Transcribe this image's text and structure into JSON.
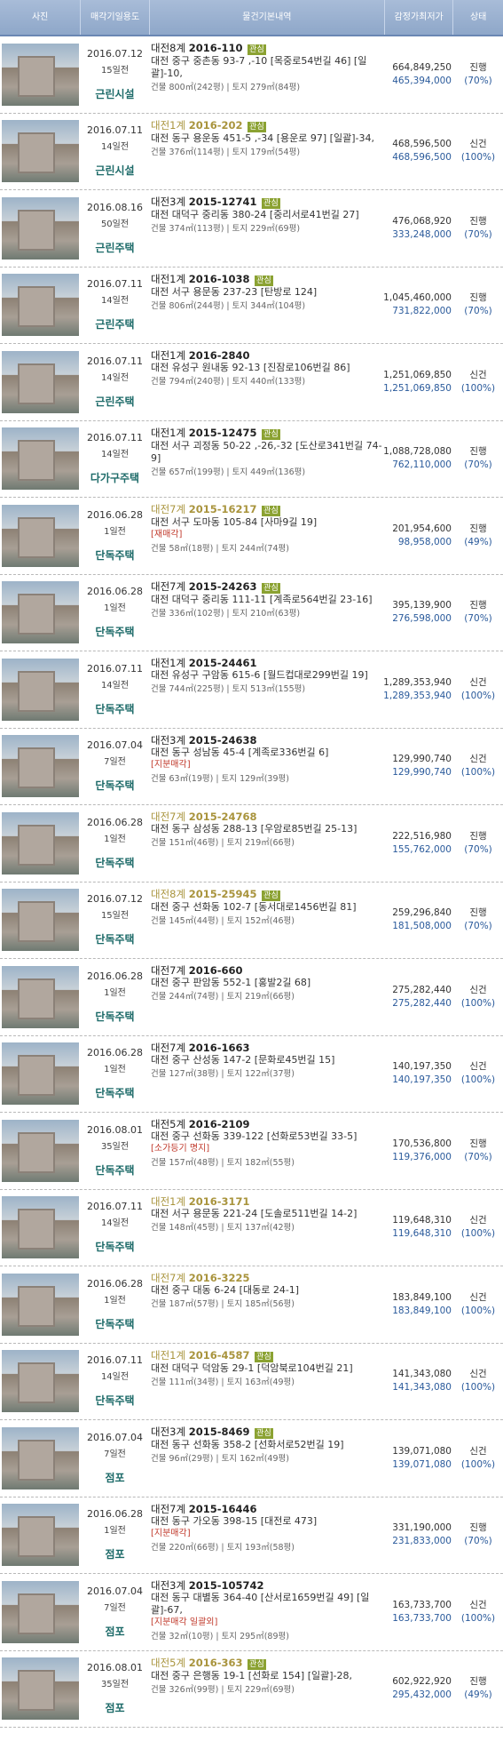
{
  "header": {
    "col_photo": "사진",
    "col_date": "매각기일",
    "col_use": "용도",
    "col_info": "물건기본내역",
    "col_appraisal": "감정가",
    "col_min": "최저가",
    "col_status": "상태"
  },
  "rows": [
    {
      "date": "2016.07.12",
      "days": "15일전",
      "use": "근린시설",
      "court": "대전8계",
      "caseno": "2016-110",
      "gray": false,
      "tag": "관심",
      "addr": "대전 중구 중촌동 93-7 ,-10 [목중로54번길 46] [일괄]-10,",
      "note": "",
      "area": "건물 800㎡(242평) | 토지 279㎡(84평)",
      "appraisal": "664,849,250",
      "min": "465,394,000",
      "status": "진행",
      "pct": "(70%)"
    },
    {
      "date": "2016.07.11",
      "days": "14일전",
      "use": "근린시설",
      "court": "대전1계",
      "caseno": "2016-202",
      "gray": true,
      "tag": "관심",
      "addr": "대전 동구 용운동 451-5 ,-34 [용운로 97] [일괄]-34,",
      "note": "",
      "area": "건물 376㎡(114평) | 토지 179㎡(54평)",
      "appraisal": "468,596,500",
      "min": "468,596,500",
      "status": "신건",
      "pct": "(100%)"
    },
    {
      "date": "2016.08.16",
      "days": "50일전",
      "use": "근린주택",
      "court": "대전3계",
      "caseno": "2015-12741",
      "gray": false,
      "tag": "관심",
      "addr": "대전 대덕구 중리동 380-24 [중리서로41번길 27]",
      "note": "",
      "area": "건물 374㎡(113평) | 토지 229㎡(69평)",
      "appraisal": "476,068,920",
      "min": "333,248,000",
      "status": "진행",
      "pct": "(70%)"
    },
    {
      "date": "2016.07.11",
      "days": "14일전",
      "use": "근린주택",
      "court": "대전1계",
      "caseno": "2016-1038",
      "gray": false,
      "tag": "관심",
      "addr": "대전 서구 용문동 237-23 [탄방로 124]",
      "note": "",
      "area": "건물 806㎡(244평) | 토지 344㎡(104평)",
      "appraisal": "1,045,460,000",
      "min": "731,822,000",
      "status": "진행",
      "pct": "(70%)"
    },
    {
      "date": "2016.07.11",
      "days": "14일전",
      "use": "근린주택",
      "court": "대전1계",
      "caseno": "2016-2840",
      "gray": false,
      "tag": "",
      "addr": "대전 유성구 원내동 92-13 [진잠로106번길 86]",
      "note": "",
      "area": "건물 794㎡(240평) | 토지 440㎡(133평)",
      "appraisal": "1,251,069,850",
      "min": "1,251,069,850",
      "status": "신건",
      "pct": "(100%)"
    },
    {
      "date": "2016.07.11",
      "days": "14일전",
      "use": "다가구주택",
      "court": "대전1계",
      "caseno": "2015-12475",
      "gray": false,
      "tag": "관심",
      "addr": "대전 서구 괴정동 50-22 ,-26,-32 [도산로341번길 74-9]",
      "note": "",
      "area": "건물 657㎡(199평) | 토지 449㎡(136평)",
      "appraisal": "1,088,728,080",
      "min": "762,110,000",
      "status": "진행",
      "pct": "(70%)"
    },
    {
      "date": "2016.06.28",
      "days": "1일전",
      "use": "단독주택",
      "court": "대전7계",
      "caseno": "2015-16217",
      "gray": true,
      "tag": "관심",
      "addr": "대전 서구 도마동 105-84 [사마9길 19]",
      "note": "[재매각]",
      "area": "건물 58㎡(18평) | 토지 244㎡(74평)",
      "appraisal": "201,954,600",
      "min": "98,958,000",
      "status": "진행",
      "pct": "(49%)"
    },
    {
      "date": "2016.06.28",
      "days": "1일전",
      "use": "단독주택",
      "court": "대전7계",
      "caseno": "2015-24263",
      "gray": false,
      "tag": "관심",
      "addr": "대전 대덕구 중리동 111-11 [계족로564번길 23-16]",
      "note": "",
      "area": "건물 336㎡(102평) | 토지 210㎡(63평)",
      "appraisal": "395,139,900",
      "min": "276,598,000",
      "status": "진행",
      "pct": "(70%)"
    },
    {
      "date": "2016.07.11",
      "days": "14일전",
      "use": "단독주택",
      "court": "대전1계",
      "caseno": "2015-24461",
      "gray": false,
      "tag": "",
      "addr": "대전 유성구 구암동 615-6 [월드컵대로299번길 19]",
      "note": "",
      "area": "건물 744㎡(225평) | 토지 513㎡(155평)",
      "appraisal": "1,289,353,940",
      "min": "1,289,353,940",
      "status": "신건",
      "pct": "(100%)"
    },
    {
      "date": "2016.07.04",
      "days": "7일전",
      "use": "단독주택",
      "court": "대전3계",
      "caseno": "2015-24638",
      "gray": false,
      "tag": "",
      "addr": "대전 동구 성남동 45-4 [계족로336번길 6]",
      "note": "[지분매각]",
      "area": "건물 63㎡(19평) | 토지 129㎡(39평)",
      "appraisal": "129,990,740",
      "min": "129,990,740",
      "status": "신건",
      "pct": "(100%)"
    },
    {
      "date": "2016.06.28",
      "days": "1일전",
      "use": "단독주택",
      "court": "대전7계",
      "caseno": "2015-24768",
      "gray": true,
      "tag": "",
      "addr": "대전 동구 삼성동 288-13 [우암로85번길 25-13]",
      "note": "",
      "area": "건물 151㎡(46평) | 토지 219㎡(66평)",
      "appraisal": "222,516,980",
      "min": "155,762,000",
      "status": "진행",
      "pct": "(70%)"
    },
    {
      "date": "2016.07.12",
      "days": "15일전",
      "use": "단독주택",
      "court": "대전8계",
      "caseno": "2015-25945",
      "gray": true,
      "tag": "관심",
      "addr": "대전 중구 선화동 102-7 [동서대로1456번길 81]",
      "note": "",
      "area": "건물 145㎡(44평) | 토지 152㎡(46평)",
      "appraisal": "259,296,840",
      "min": "181,508,000",
      "status": "진행",
      "pct": "(70%)"
    },
    {
      "date": "2016.06.28",
      "days": "1일전",
      "use": "단독주택",
      "court": "대전7계",
      "caseno": "2016-660",
      "gray": false,
      "tag": "",
      "addr": "대전 중구 판암동 552-1 [홍발2길 68]",
      "note": "",
      "area": "건물 244㎡(74평) | 토지 219㎡(66평)",
      "appraisal": "275,282,440",
      "min": "275,282,440",
      "status": "신건",
      "pct": "(100%)"
    },
    {
      "date": "2016.06.28",
      "days": "1일전",
      "use": "단독주택",
      "court": "대전7계",
      "caseno": "2016-1663",
      "gray": false,
      "tag": "",
      "addr": "대전 중구 산성동 147-2 [문화로45번길 15]",
      "note": "",
      "area": "건물 127㎡(38평) | 토지 122㎡(37평)",
      "appraisal": "140,197,350",
      "min": "140,197,350",
      "status": "신건",
      "pct": "(100%)"
    },
    {
      "date": "2016.08.01",
      "days": "35일전",
      "use": "단독주택",
      "court": "대전5계",
      "caseno": "2016-2109",
      "gray": false,
      "tag": "",
      "addr": "대전 중구 선화동 339-122 [선화로53번길 33-5]",
      "note": "[소가등기 명지]",
      "area": "건물 157㎡(48평) | 토지 182㎡(55평)",
      "appraisal": "170,536,800",
      "min": "119,376,000",
      "status": "진행",
      "pct": "(70%)"
    },
    {
      "date": "2016.07.11",
      "days": "14일전",
      "use": "단독주택",
      "court": "대전1계",
      "caseno": "2016-3171",
      "gray": true,
      "tag": "",
      "addr": "대전 서구 용문동 221-24 [도솔로511번길 14-2]",
      "note": "",
      "area": "건물 148㎡(45평) | 토지 137㎡(42평)",
      "appraisal": "119,648,310",
      "min": "119,648,310",
      "status": "신건",
      "pct": "(100%)"
    },
    {
      "date": "2016.06.28",
      "days": "1일전",
      "use": "단독주택",
      "court": "대전7계",
      "caseno": "2016-3225",
      "gray": true,
      "tag": "",
      "addr": "대전 중구 대동 6-24 [대동로 24-1]",
      "note": "",
      "area": "건물 187㎡(57평) | 토지 185㎡(56평)",
      "appraisal": "183,849,100",
      "min": "183,849,100",
      "status": "신건",
      "pct": "(100%)"
    },
    {
      "date": "2016.07.11",
      "days": "14일전",
      "use": "단독주택",
      "court": "대전1계",
      "caseno": "2016-4587",
      "gray": true,
      "tag": "관심",
      "addr": "대전 대덕구 덕암동 29-1 [덕암북로104번길 21]",
      "note": "",
      "area": "건물 111㎡(34평) | 토지 163㎡(49평)",
      "appraisal": "141,343,080",
      "min": "141,343,080",
      "status": "신건",
      "pct": "(100%)"
    },
    {
      "date": "2016.07.04",
      "days": "7일전",
      "use": "점포",
      "court": "대전3계",
      "caseno": "2015-8469",
      "gray": false,
      "tag": "관심",
      "addr": "대전 동구 선화동 358-2 [선화서로52번길 19]",
      "note": "",
      "area": "건물 96㎡(29평) | 토지 162㎡(49평)",
      "appraisal": "139,071,080",
      "min": "139,071,080",
      "status": "신건",
      "pct": "(100%)"
    },
    {
      "date": "2016.06.28",
      "days": "1일전",
      "use": "점포",
      "court": "대전7계",
      "caseno": "2015-16446",
      "gray": false,
      "tag": "",
      "addr": "대전 동구 가오동 398-15 [대전로 473]",
      "note": "[지분매각]",
      "area": "건물 220㎡(66평) | 토지 193㎡(58평)",
      "appraisal": "331,190,000",
      "min": "231,833,000",
      "status": "진행",
      "pct": "(70%)"
    },
    {
      "date": "2016.07.04",
      "days": "7일전",
      "use": "점포",
      "court": "대전3계",
      "caseno": "2015-105742",
      "gray": false,
      "tag": "",
      "addr": "대전 동구 대별동 364-40 [산서로1659번길 49] [일괄]-67,",
      "note": "[지분매각 일괄외]",
      "area": "건물 32㎡(10평) | 토지 295㎡(89평)",
      "appraisal": "163,733,700",
      "min": "163,733,700",
      "status": "신건",
      "pct": "(100%)"
    },
    {
      "date": "2016.08.01",
      "days": "35일전",
      "use": "점포",
      "court": "대전5계",
      "caseno": "2016-363",
      "gray": true,
      "tag": "관심",
      "addr": "대전 중구 은행동 19-1 [선화로 154] [일괄]-28,",
      "note": "",
      "area": "건물 326㎡(99평) | 토지 229㎡(69평)",
      "appraisal": "602,922,920",
      "min": "295,432,000",
      "status": "진행",
      "pct": "(49%)"
    }
  ]
}
